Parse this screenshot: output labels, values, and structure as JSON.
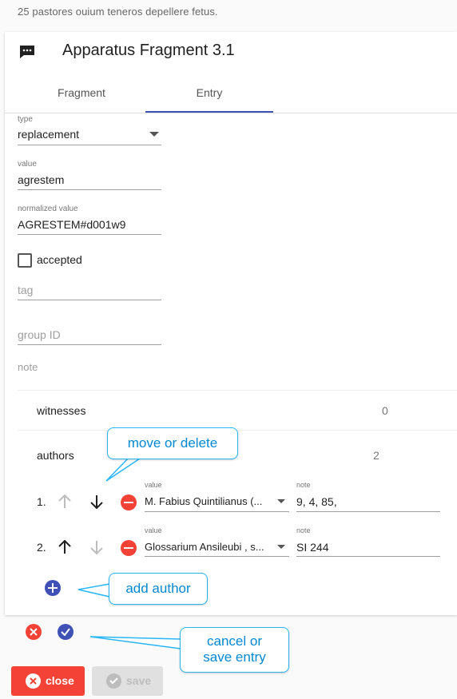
{
  "header": {
    "subtitle": "25  pastores ouium teneros depellere fetus."
  },
  "card": {
    "title": "Apparatus Fragment 3.1",
    "icon": "comment-icon"
  },
  "tabs": [
    {
      "label": "Fragment"
    },
    {
      "label": "Entry",
      "active": true
    }
  ],
  "form": {
    "type": {
      "label": "type",
      "value": "replacement"
    },
    "value": {
      "label": "value",
      "value": "agrestem"
    },
    "normalized": {
      "label": "normalized value",
      "value": "AGRESTEM#d001w9"
    },
    "accepted": {
      "label": "accepted",
      "checked": false
    },
    "tag": {
      "placeholder": "tag"
    },
    "group": {
      "placeholder": "group ID"
    },
    "note": {
      "placeholder": "note"
    }
  },
  "witnesses": {
    "title": "witnesses",
    "count": "0"
  },
  "authors": {
    "title": "authors",
    "count": "2",
    "items": [
      {
        "index": "1.",
        "value_label": "value",
        "value": "M. Fabius Quintilianus (...",
        "note_label": "note",
        "note": "9, 4, 85,"
      },
      {
        "index": "2.",
        "value_label": "value",
        "value": "Glossarium Ansileubi , s...",
        "note_label": "note",
        "note": "SI 244"
      }
    ]
  },
  "callouts": {
    "move": "move or delete",
    "add": "add author",
    "cancel_line1": "cancel or",
    "cancel_line2": "save entry"
  },
  "buttons": {
    "close": "close",
    "save": "save"
  },
  "colors": {
    "primary": "#3f51b5",
    "danger": "#f44336",
    "callout": "#29b6f6"
  }
}
